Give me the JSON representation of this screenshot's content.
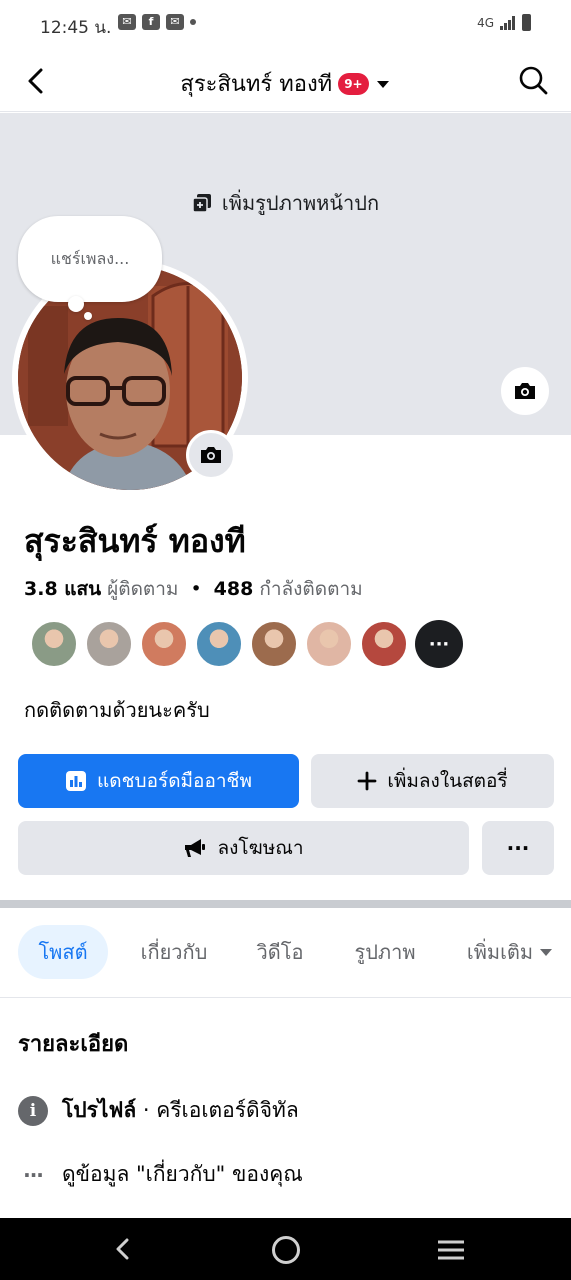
{
  "status_bar": {
    "time": "12:45 น.",
    "network": "4G"
  },
  "header": {
    "title": "สุระสินทร์ ทองที",
    "badge": "9+"
  },
  "cover": {
    "add_cover_label": "เพิ่มรูปภาพหน้าปก"
  },
  "note_bubble": {
    "text": "แชร์เพลง..."
  },
  "profile": {
    "name": "สุระสินทร์ ทองที",
    "followers_count": "3.8 แสน",
    "followers_label": "ผู้ติดตาม",
    "separator": "•",
    "following_count": "488",
    "following_label": "กำลังติดตาม",
    "bio": "กดติดตามด้วยนะครับ",
    "friend_avatars": [
      {
        "color": "#8a9b86"
      },
      {
        "color": "#a9a29c"
      },
      {
        "color": "#d07b5f"
      },
      {
        "color": "#4e8fb8"
      },
      {
        "color": "#9c6b4d"
      },
      {
        "color": "#e0b6a4"
      },
      {
        "color": "#b5483e"
      }
    ],
    "friends_more": "···"
  },
  "actions": {
    "dashboard": "แดชบอร์ดมืออาชีพ",
    "add_story": "เพิ่มลงในสตอรี่",
    "advertise": "ลงโฆษณา",
    "more": "···"
  },
  "tabs": [
    {
      "label": "โพสต์",
      "active": true
    },
    {
      "label": "เกี่ยวกับ",
      "active": false
    },
    {
      "label": "วิดีโอ",
      "active": false
    },
    {
      "label": "รูปภาพ",
      "active": false
    },
    {
      "label": "เพิ่มเติม",
      "active": false
    }
  ],
  "details": {
    "title": "รายละเอียด",
    "profile_label": "โปรไฟล์",
    "profile_value": "· ครีเอเตอร์ดิจิทัล",
    "about_link": "ดูข้อมูล \"เกี่ยวกับ\" ของคุณ"
  },
  "colors": {
    "accent": "#1877f2",
    "badge": "#e41e3f",
    "cover": "#e4e6eb"
  }
}
